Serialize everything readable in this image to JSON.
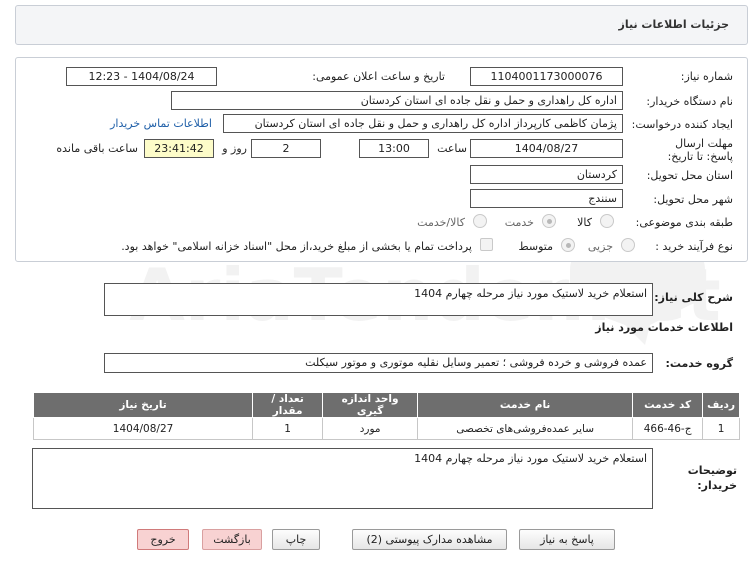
{
  "header": {
    "title": "جزئیات اطلاعات نیاز"
  },
  "form": {
    "need_number_label": "شماره نیاز:",
    "need_number": "1104001173000076",
    "announce_label": "تاریخ و ساعت اعلان عمومی:",
    "announce_value": "1404/08/24 - 12:23",
    "buyer_org_label": "نام دستگاه خریدار:",
    "buyer_org": "اداره کل راهداری و حمل و نقل جاده ای استان کردستان",
    "creator_label": "ایجاد کننده درخواست:",
    "creator": "پژمان کاظمی کارپرداز اداره کل راهداری و حمل و نقل جاده ای استان کردستان",
    "contact_link": "اطلاعات تماس خریدار",
    "deadline_label": "مهلت ارسال پاسخ: تا تاریخ:",
    "deadline_date": "1404/08/27",
    "time_label": "ساعت",
    "deadline_time": "13:00",
    "days_value": "2",
    "days_label": "روز و",
    "remaining_time": "23:41:42",
    "remaining_label": "ساعت باقی مانده",
    "province_label": "استان محل تحویل:",
    "province": "کردستان",
    "city_label": "شهر محل تحویل:",
    "city": "سنندج",
    "category_label": "طبقه بندی موضوعی:",
    "category_options": [
      "کالا",
      "خدمت",
      "کالا/خدمت"
    ],
    "process_label": "نوع فرآیند خرید :",
    "process_options": [
      "جزیی",
      "متوسط"
    ],
    "payment_note": "پرداخت تمام یا بخشی از مبلغ خرید،از محل \"اسناد خزانه اسلامی\" خواهد بود."
  },
  "summary": {
    "label": "شرح کلی نیاز:",
    "value": "استعلام خرید لاستیک مورد نیاز مرحله چهارم 1404"
  },
  "services": {
    "section_title": "اطلاعات خدمات مورد نیاز",
    "group_label": "گروه خدمت:",
    "group_value": "عمده فروشی و خرده فروشی ؛ تعمیر وسایل نقلیه موتوری و موتور سیکلت",
    "columns": [
      "ردیف",
      "کد خدمت",
      "نام خدمت",
      "واحد اندازه گیری",
      "تعداد / مقدار",
      "تاریخ نیاز"
    ],
    "rows": [
      [
        "1",
        "ج-46-466",
        "سایر عمده‌فروشی‌های تخصصی",
        "مورد",
        "1",
        "1404/08/27"
      ]
    ]
  },
  "buyer_notes": {
    "label": "توضیحات خریدار:",
    "value": "استعلام خرید لاستیک مورد نیاز مرحله چهارم 1404"
  },
  "buttons": {
    "reply": "پاسخ به نیاز",
    "docs": "مشاهده مدارک پیوستی (2)",
    "print": "چاپ",
    "back": "بازگشت",
    "exit": "خروج"
  },
  "colors": {
    "table_header": "#6e6e6e",
    "link": "#1f5fa8",
    "deadline_bg": "#fdfcc9",
    "exit_button": "#f8d2d2"
  }
}
